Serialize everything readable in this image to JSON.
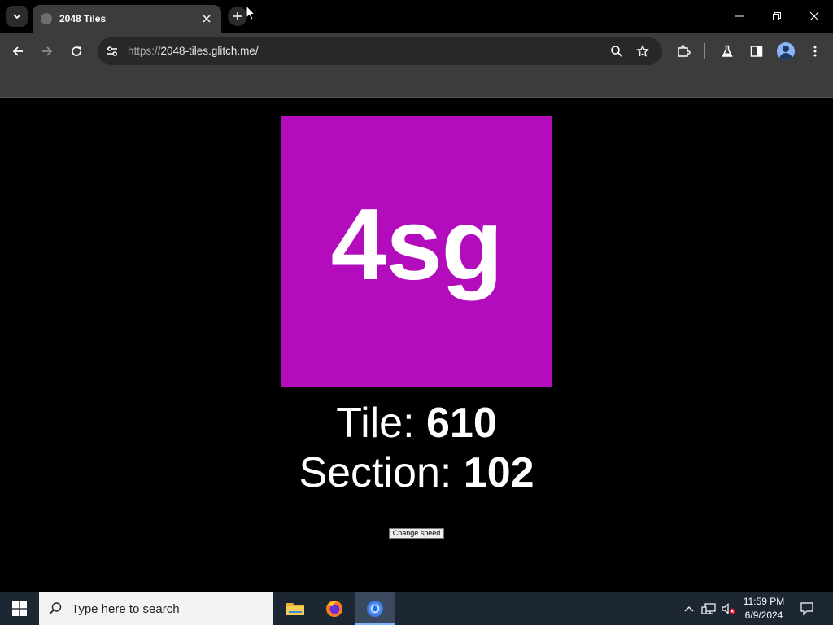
{
  "browser": {
    "tab_title": "2048 Tiles",
    "url_scheme": "https://",
    "url_host": "2048-tiles.glitch.me/",
    "icons": {
      "tab_search": "chevron-down-icon",
      "favicon": "globe-icon",
      "tab_close": "close-icon",
      "new_tab": "plus-icon",
      "minimize": "minimize-icon",
      "restore": "restore-icon",
      "close_window": "close-icon",
      "back": "arrow-left-icon",
      "forward": "arrow-right-icon",
      "reload": "reload-icon",
      "site_info": "tune-icon",
      "zoom": "zoom-icon",
      "bookmark": "star-icon",
      "extensions": "puzzle-icon",
      "labs": "flask-icon",
      "side_panel": "side-panel-icon",
      "profile": "avatar-icon",
      "menu": "kebab-menu-icon"
    }
  },
  "game": {
    "tile_value": "4sg",
    "tile_color": "#b30cbd",
    "tile_label": "Tile: ",
    "tile_number": "610",
    "section_label": "Section: ",
    "section_number": "102",
    "change_speed_label": "Change speed"
  },
  "taskbar": {
    "search_placeholder": "Type here to search",
    "time": "11:59 PM",
    "date": "6/9/2024",
    "apps": [
      "file-explorer-icon",
      "firefox-icon",
      "chrome-icon"
    ]
  }
}
